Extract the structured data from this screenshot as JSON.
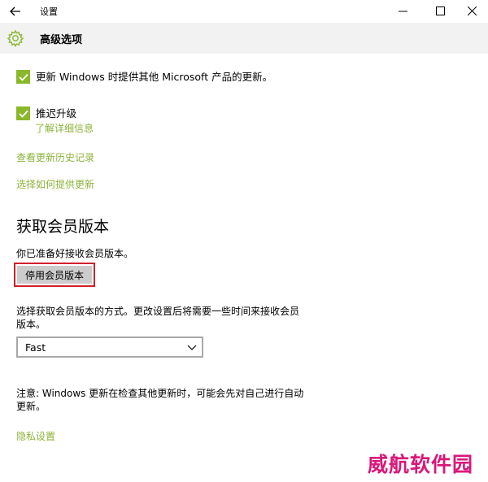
{
  "window": {
    "title": "设置"
  },
  "header": {
    "page_title": "高级选项"
  },
  "options": {
    "ms_updates_label": "更新 Windows 时提供其他 Microsoft 产品的更新。",
    "ms_updates_checked": true,
    "defer_label": "推迟升级",
    "defer_checked": true,
    "learn_more": "了解详细信息"
  },
  "links": {
    "history": "查看更新历史记录",
    "delivery": "选择如何提供更新",
    "privacy": "隐私设置"
  },
  "insider": {
    "section_title": "获取会员版本",
    "ready_text": "你已准备好接收会员版本。",
    "stop_button": "停用会员版本",
    "pace_line1": "选择获取会员版本的方式。更改设置后将需要一些时间来接收会员",
    "pace_line2": "版本。",
    "pace_value": "Fast",
    "note_line1": "注意: Windows 更新在检查其他更新时，可能会先对自己进行自动",
    "note_line2": "更新。"
  },
  "watermark": "威航软件园",
  "colors": {
    "accent": "#8ab82d",
    "link": "#8cb33a",
    "highlight_border": "#d21f2b",
    "watermark": "#d8187a"
  }
}
